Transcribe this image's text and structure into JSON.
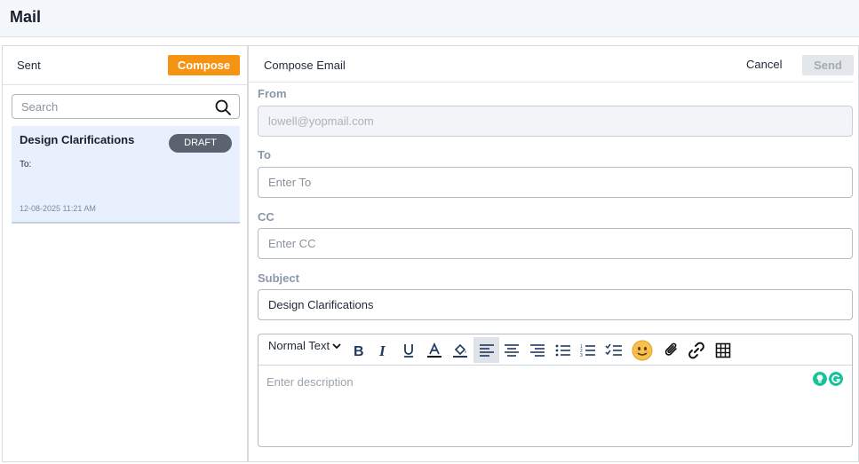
{
  "header": {
    "title": "Mail"
  },
  "left": {
    "tab_label": "Sent",
    "compose_label": "Compose",
    "search_placeholder": "Search",
    "mail_item": {
      "subject": "Design Clarifications",
      "badge": "DRAFT",
      "to_label": "To:",
      "timestamp": "12-08-2025 11:21 AM"
    }
  },
  "compose": {
    "title": "Compose Email",
    "cancel_label": "Cancel",
    "send_label": "Send",
    "from_label": "From",
    "from_value": "lowell@yopmail.com",
    "to_label": "To",
    "to_placeholder": "Enter To",
    "cc_label": "CC",
    "cc_placeholder": "Enter CC",
    "subject_label": "Subject",
    "subject_value": "Design Clarifications",
    "toolbar": {
      "text_style": "Normal Text"
    },
    "description_placeholder": "Enter description"
  },
  "colors": {
    "accent_orange": "#f59313",
    "draft_badge": "#5c6370",
    "selected_item_bg": "#e8f0fe",
    "grammarly_green": "#15c39a"
  },
  "icons": [
    "search-icon",
    "bold-icon",
    "italic-icon",
    "underline-icon",
    "text-color-icon",
    "highlight-icon",
    "align-left-icon",
    "align-center-icon",
    "align-right-icon",
    "bullet-list-icon",
    "numbered-list-icon",
    "checklist-icon",
    "emoji-icon",
    "attachment-icon",
    "link-icon",
    "table-icon",
    "lightbulb-icon",
    "grammarly-icon"
  ]
}
